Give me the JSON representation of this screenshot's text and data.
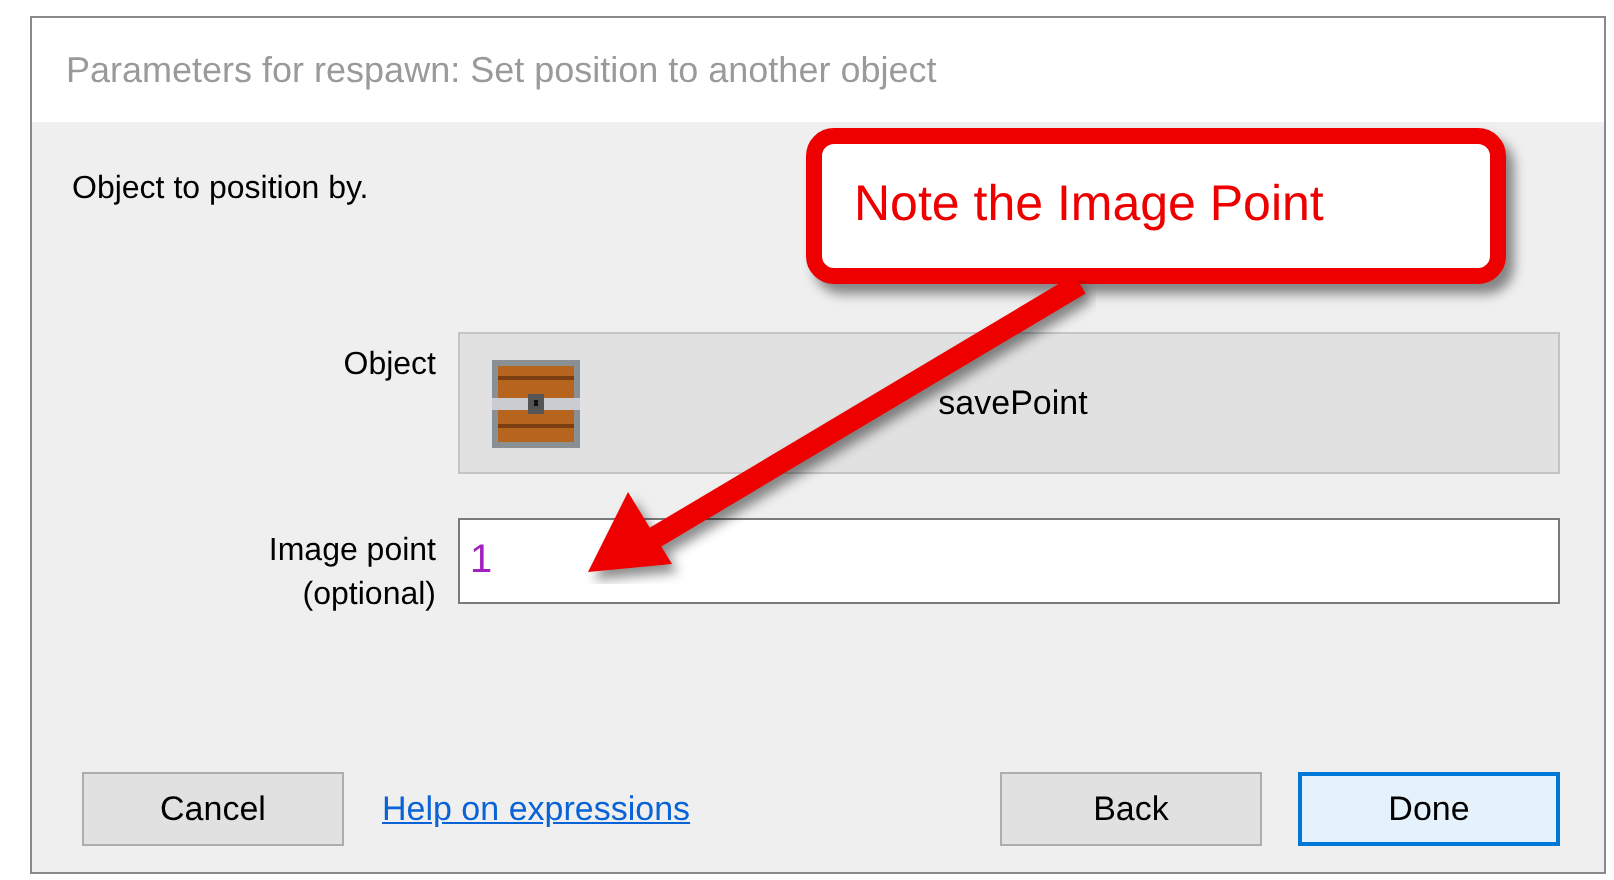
{
  "window": {
    "title": "Parameters for respawn: Set position to another object"
  },
  "description": "Object to position by.",
  "callout": {
    "text": "Note the Image Point"
  },
  "fields": [
    {
      "kind": "object",
      "label": "Object",
      "value": "savePoint"
    },
    {
      "kind": "text",
      "label": "Image point (optional)",
      "value": "1"
    }
  ],
  "buttons": [
    {
      "kind": "button",
      "label": "Cancel",
      "focused": false
    },
    {
      "kind": "link",
      "label": "Help on expressions",
      "focused": false
    },
    {
      "kind": "button",
      "label": "Back",
      "focused": false
    },
    {
      "kind": "button",
      "label": "Done",
      "focused": true
    }
  ]
}
